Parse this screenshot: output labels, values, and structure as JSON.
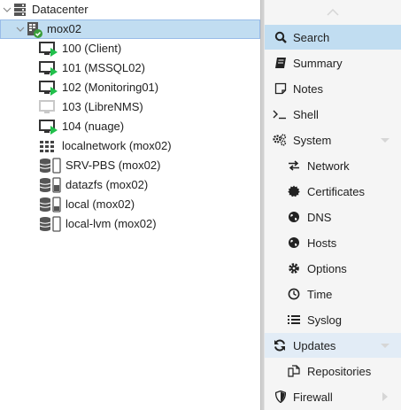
{
  "tree": {
    "datacenter": {
      "label": "Datacenter",
      "icon": "server-stack-icon"
    },
    "node": {
      "label": "mox02",
      "icon": "node-online-icon",
      "status_color": "#3a9e3a"
    },
    "vms": [
      {
        "label": "100 (Client)",
        "icon": "vm-running-icon",
        "status": "running"
      },
      {
        "label": "101 (MSSQL02)",
        "icon": "vm-running-icon",
        "status": "running"
      },
      {
        "label": "102 (Monitoring01)",
        "icon": "vm-running-icon",
        "status": "running"
      },
      {
        "label": "103 (LibreNMS)",
        "icon": "vm-stopped-icon",
        "status": "stopped"
      },
      {
        "label": "104 (nuage)",
        "icon": "vm-running-icon",
        "status": "running"
      }
    ],
    "resources": [
      {
        "label": "localnetwork (mox02)",
        "icon": "sdn-grid-icon"
      },
      {
        "label": "SRV-PBS (mox02)",
        "icon": "backup-storage-icon"
      },
      {
        "label": "datazfs (mox02)",
        "icon": "storage-icon"
      },
      {
        "label": "local (mox02)",
        "icon": "storage-icon"
      },
      {
        "label": "local-lvm (mox02)",
        "icon": "storage-icon"
      }
    ]
  },
  "menu": {
    "items": [
      {
        "label": "Search",
        "icon": "search-icon",
        "indent": false,
        "state": "active"
      },
      {
        "label": "Summary",
        "icon": "book-icon",
        "indent": false,
        "state": ""
      },
      {
        "label": "Notes",
        "icon": "notes-icon",
        "indent": false,
        "state": ""
      },
      {
        "label": "Shell",
        "icon": "terminal-icon",
        "indent": false,
        "state": ""
      },
      {
        "label": "System",
        "icon": "gears-icon",
        "indent": false,
        "state": "",
        "arrow": "down"
      },
      {
        "label": "Network",
        "icon": "exchange-icon",
        "indent": true,
        "state": ""
      },
      {
        "label": "Certificates",
        "icon": "certificate-icon",
        "indent": true,
        "state": ""
      },
      {
        "label": "DNS",
        "icon": "globe-icon",
        "indent": true,
        "state": ""
      },
      {
        "label": "Hosts",
        "icon": "globe-icon",
        "indent": true,
        "state": ""
      },
      {
        "label": "Options",
        "icon": "gear-icon",
        "indent": true,
        "state": ""
      },
      {
        "label": "Time",
        "icon": "clock-icon",
        "indent": true,
        "state": ""
      },
      {
        "label": "Syslog",
        "icon": "list-icon",
        "indent": true,
        "state": ""
      },
      {
        "label": "Updates",
        "icon": "refresh-icon",
        "indent": false,
        "state": "hl",
        "arrow": "down"
      },
      {
        "label": "Repositories",
        "icon": "files-icon",
        "indent": true,
        "state": ""
      },
      {
        "label": "Firewall",
        "icon": "shield-icon",
        "indent": false,
        "state": "",
        "arrow": "right"
      }
    ]
  },
  "colors": {
    "selection": "#c1ddf1",
    "running": "#21bf4b",
    "menu_bg": "#f5f5f5",
    "text": "#212121"
  }
}
